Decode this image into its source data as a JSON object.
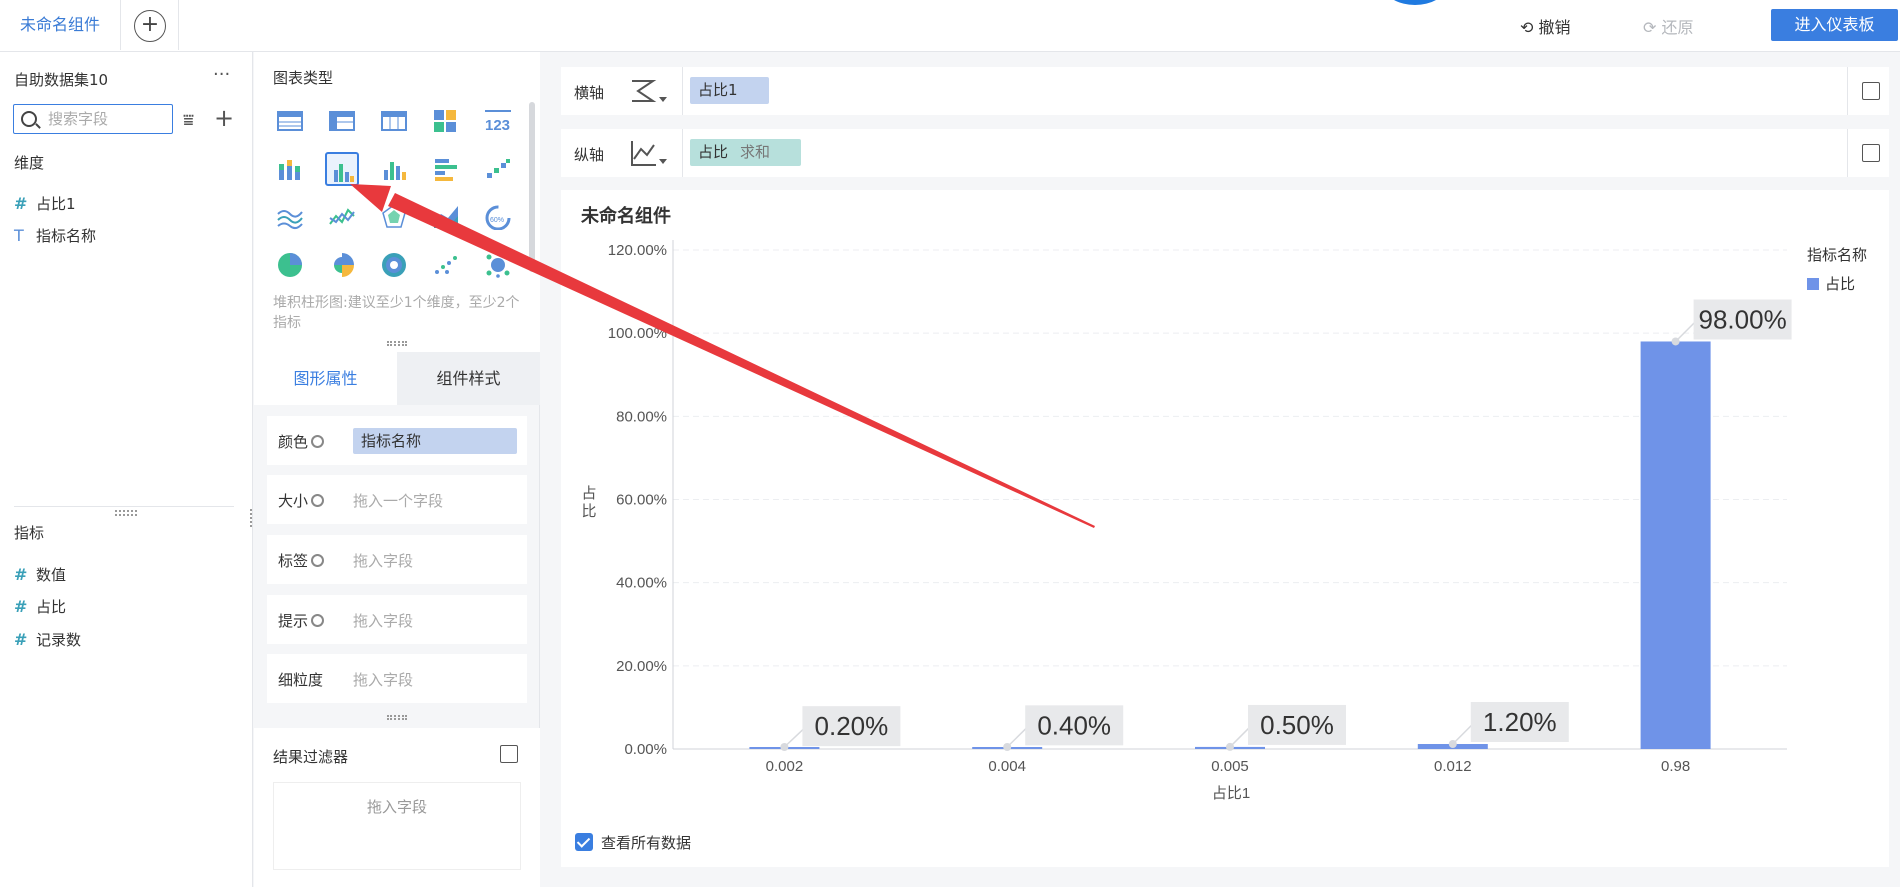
{
  "topbar": {
    "tab_label": "未命名组件",
    "add_tab": "+",
    "undo_label": "撤销",
    "redo_label": "还原",
    "enter_dashboard": "进入仪表板"
  },
  "left": {
    "dataset_title": "自助数据集10",
    "more": "···",
    "search_placeholder": "搜索字段",
    "dimension_title": "维度",
    "dimensions": [
      "占比1",
      "指标名称"
    ],
    "metric_title": "指标",
    "metrics": [
      "数值",
      "占比",
      "记录数"
    ]
  },
  "middle": {
    "chart_type_title": "图表类型",
    "chart_hint": "堆积柱形图:建议至少1个维度，至少2个指标",
    "tab_graph_props": "图形属性",
    "tab_component_style": "组件样式",
    "props": [
      {
        "label": "颜色",
        "value": "指标名称"
      },
      {
        "label": "大小",
        "value": "拖入一个字段"
      },
      {
        "label": "标签",
        "value": "拖入字段"
      },
      {
        "label": "提示",
        "value": "拖入字段"
      },
      {
        "label": "细粒度",
        "value": "拖入字段"
      }
    ],
    "filter_title": "结果过滤器",
    "filter_drop": "拖入字段"
  },
  "axes": {
    "x_label": "横轴",
    "x_field": "占比1",
    "y_label": "纵轴",
    "y_field": "占比",
    "y_agg": "求和"
  },
  "chart_card": {
    "title": "未命名组件",
    "view_all": "查看所有数据"
  },
  "chart_data": {
    "type": "bar",
    "title": "未命名组件",
    "xlabel": "占比1",
    "ylabel": "占比",
    "categories": [
      "0.002",
      "0.004",
      "0.005",
      "0.012",
      "0.98"
    ],
    "series": [
      {
        "name": "占比",
        "values": [
          0.2,
          0.4,
          0.5,
          1.2,
          98.0
        ],
        "data_labels": [
          "0.20%",
          "0.40%",
          "0.50%",
          "1.20%",
          "98.00%"
        ]
      }
    ],
    "ylim": [
      0,
      120
    ],
    "yticks": [
      "0.00%",
      "20.00%",
      "40.00%",
      "60.00%",
      "80.00%",
      "100.00%",
      "120.00%"
    ],
    "legend_title": "指标名称",
    "legend_position": "top-right",
    "grid": true,
    "bar_color": "#6f93e8"
  },
  "colors": {
    "accent": "#3a7ee0",
    "arrow": "#e8393d"
  }
}
